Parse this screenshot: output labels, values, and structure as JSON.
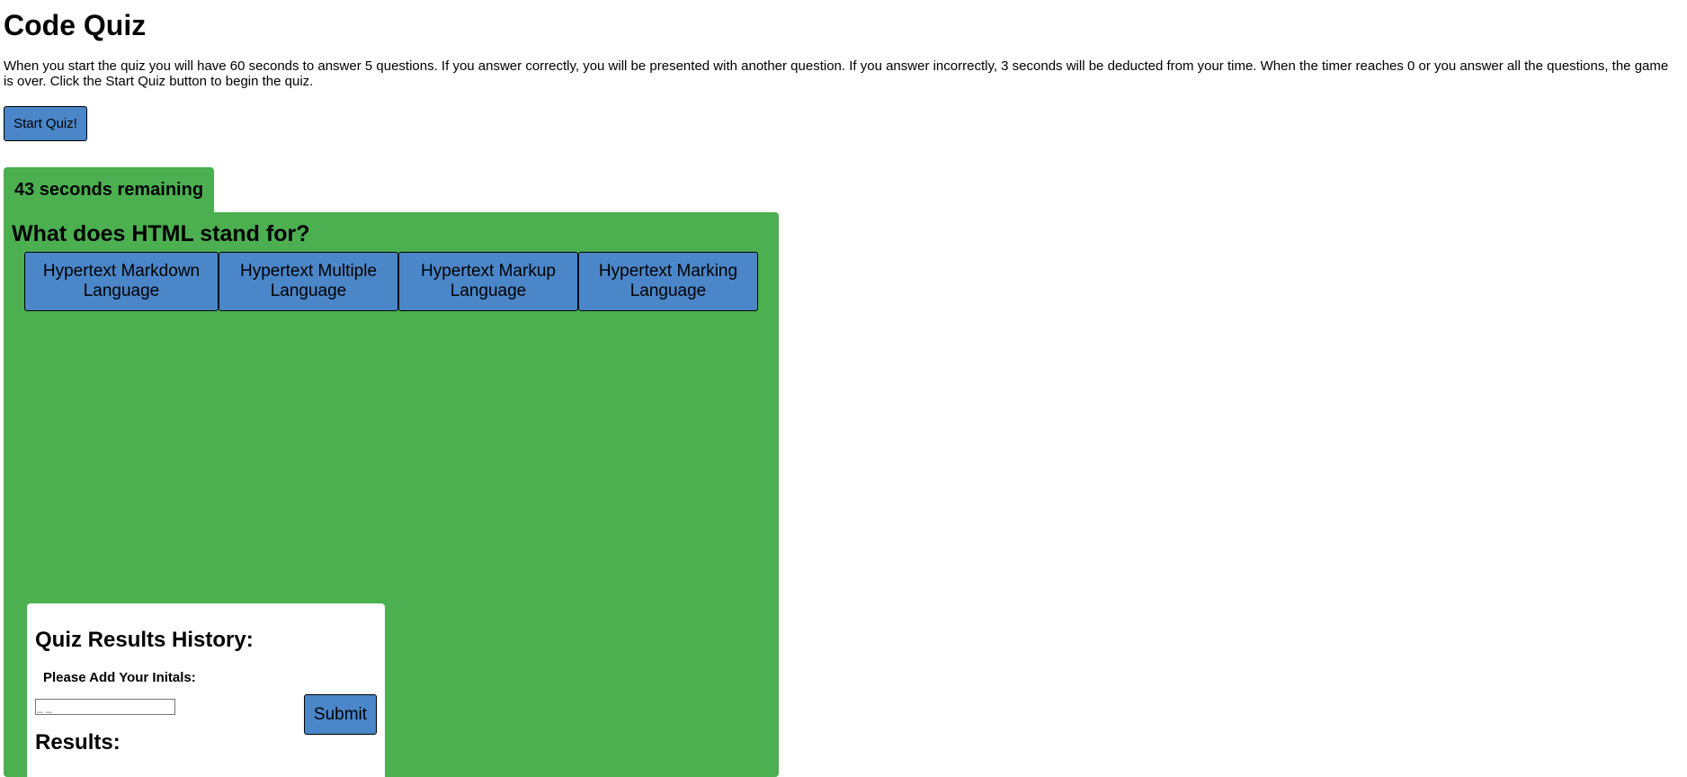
{
  "page": {
    "title": "Code Quiz",
    "intro": "When you start the quiz you will have 60 seconds to answer 5 questions. If you answer correctly, you will be presented with another question. If you answer incorrectly, 3 seconds will be deducted from your time. When the timer reaches 0 or you answer all the questions, the game is over. Click the Start Quiz button to begin the quiz.",
    "start_button": "Start Quiz!"
  },
  "timer": {
    "text": "43 seconds remaining"
  },
  "quiz": {
    "question": "What does HTML stand for?",
    "answers": [
      "Hypertext Markdown Language",
      "Hypertext Multiple Language",
      "Hypertext Markup Language",
      "Hypertext Marking Language"
    ]
  },
  "results": {
    "title": "Quiz Results History:",
    "initials_label": "Please Add Your Initals:",
    "initials_placeholder": "_ _",
    "submit_label": "Submit",
    "results_heading": "Results:"
  },
  "colors": {
    "panel_green": "#4caf50",
    "button_blue": "#4a86c8",
    "card_white": "#ffffff"
  }
}
